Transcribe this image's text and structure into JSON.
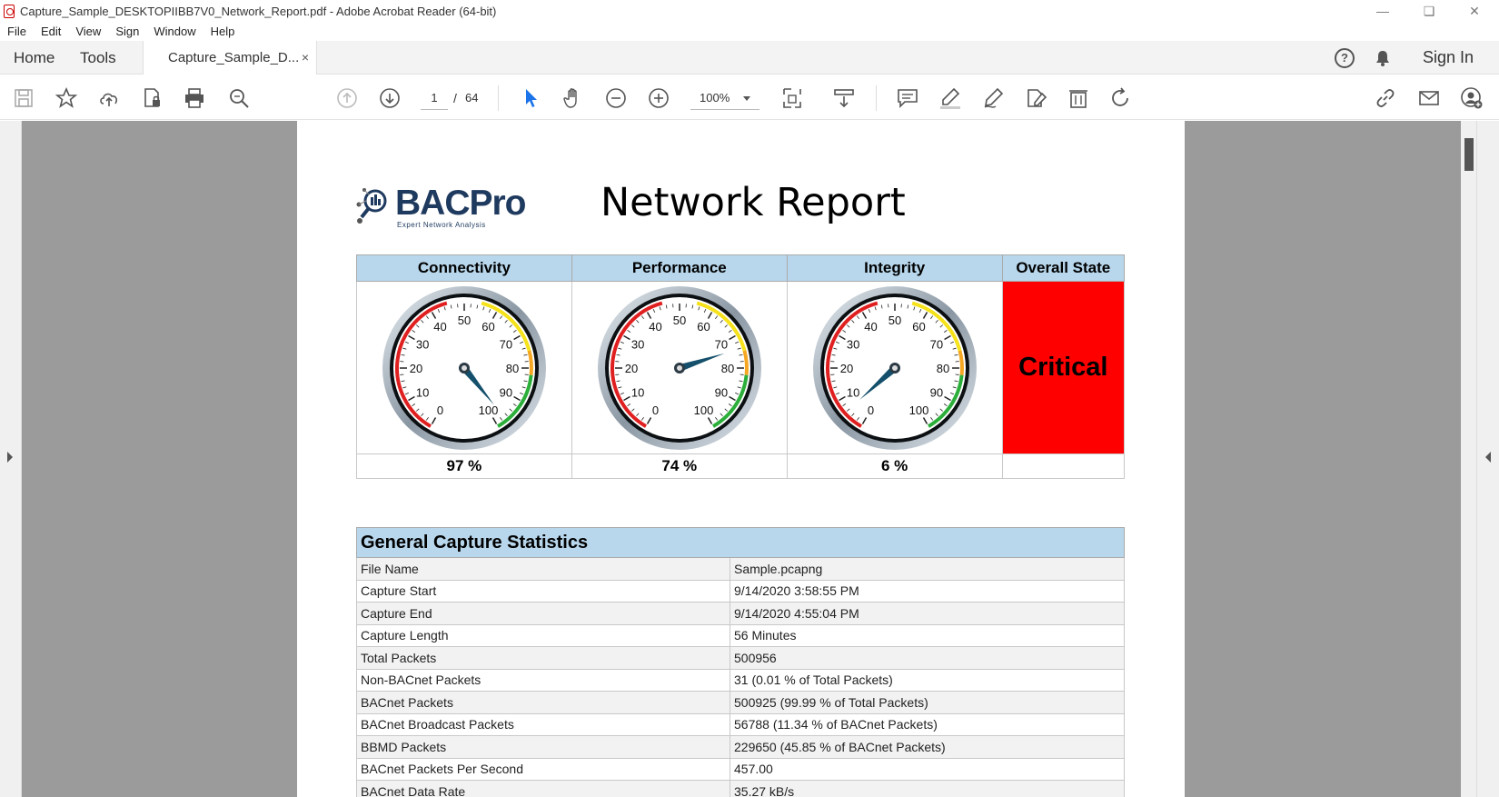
{
  "window": {
    "title": "Capture_Sample_DESKTOPIIBB7V0_Network_Report.pdf - Adobe Acrobat Reader (64-bit)"
  },
  "menu": [
    "File",
    "Edit",
    "View",
    "Sign",
    "Window",
    "Help"
  ],
  "tabs": {
    "home": "Home",
    "tools": "Tools",
    "document": "Capture_Sample_D...",
    "close": "×"
  },
  "header": {
    "signin": "Sign In",
    "help": "?"
  },
  "toolbar": {
    "page_current": "1",
    "page_sep": "/",
    "page_total": "64",
    "zoom": "100%"
  },
  "report": {
    "logo_name": "BACPro",
    "logo_tag": "Expert Network Analysis",
    "title": "Network Report",
    "gauges": [
      {
        "header": "Connectivity",
        "value": 97,
        "label": "97 %"
      },
      {
        "header": "Performance",
        "value": 74,
        "label": "74 %"
      },
      {
        "header": "Integrity",
        "value": 6,
        "label": "6 %"
      }
    ],
    "gauge_ticks": [
      "0",
      "10",
      "20",
      "30",
      "40",
      "50",
      "60",
      "70",
      "80",
      "90",
      "100"
    ],
    "overall": {
      "header": "Overall State",
      "state": "Critical",
      "color": "#ff0000"
    },
    "stats": {
      "title": "General Capture Statistics",
      "rows": [
        [
          "File Name",
          "Sample.pcapng"
        ],
        [
          "Capture Start",
          "9/14/2020 3:58:55 PM"
        ],
        [
          "Capture End",
          "9/14/2020 4:55:04 PM"
        ],
        [
          "Capture Length",
          "56 Minutes"
        ],
        [
          "Total Packets",
          "500956"
        ],
        [
          "Non-BACnet Packets",
          "31 (0.01 % of Total Packets)"
        ],
        [
          "BACnet Packets",
          "500925 (99.99 % of Total Packets)"
        ],
        [
          "BACnet Broadcast Packets",
          "56788 (11.34 % of BACnet Packets)"
        ],
        [
          "BBMD Packets",
          "229650 (45.85 % of BACnet Packets)"
        ],
        [
          "BACnet Packets Per Second",
          "457.00"
        ],
        [
          "BACnet Data Rate",
          "35.27 kB/s"
        ]
      ]
    }
  }
}
